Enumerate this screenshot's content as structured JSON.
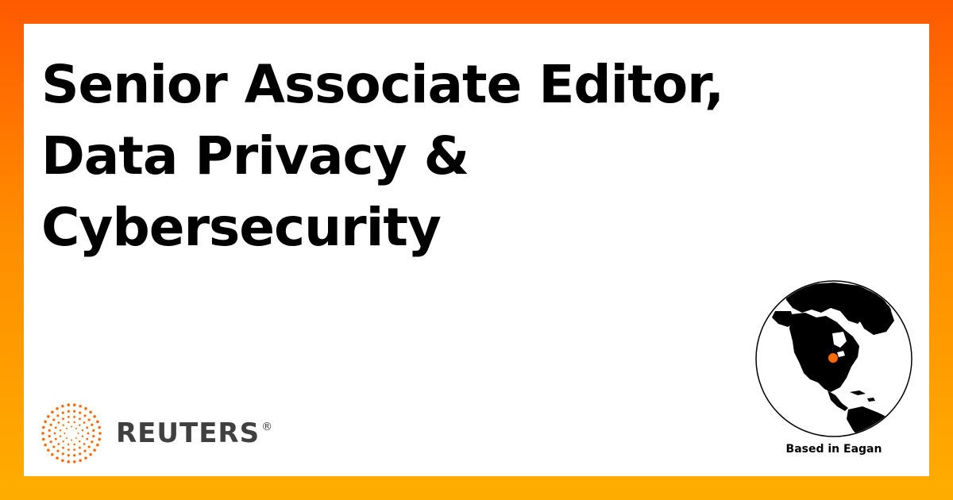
{
  "title": {
    "line1": "Senior Associate Editor,",
    "line2": "Data Privacy &",
    "line3": "Cybersecurity"
  },
  "brand": {
    "wordmark": "REUTERS",
    "registered": "®",
    "icon": "reuters-dot-logo-icon"
  },
  "location": {
    "caption": "Based in Eagan",
    "icon": "globe-icon"
  },
  "colors": {
    "gradient_top": "#ff5a00",
    "gradient_bottom": "#ffad00",
    "accent": "#ff6a00",
    "wordmark": "#404040"
  }
}
